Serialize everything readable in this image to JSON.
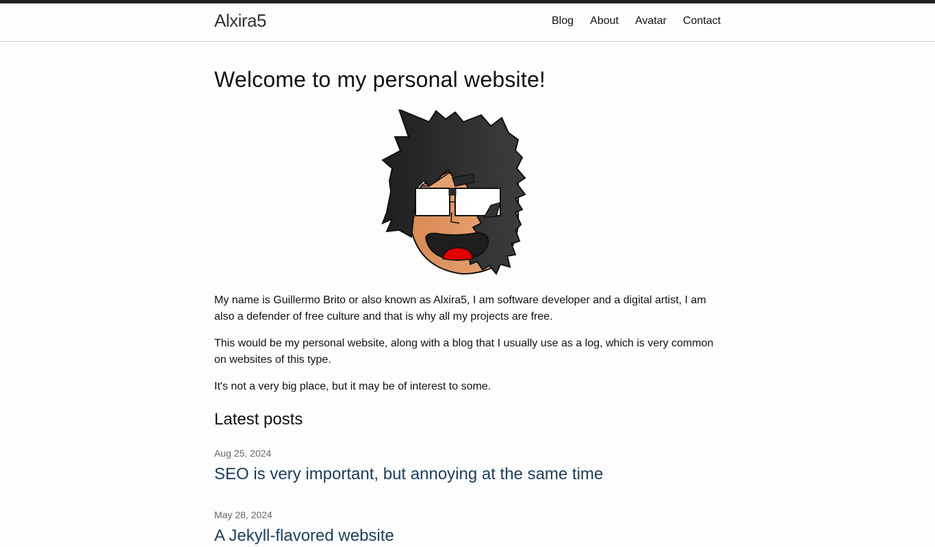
{
  "header": {
    "site_title": "Alxira5",
    "nav": [
      "Blog",
      "About",
      "Avatar",
      "Contact"
    ]
  },
  "main": {
    "heading": "Welcome to my personal website!",
    "paragraphs": [
      "My name is Guillermo Brito or also known as Alxira5, I am software developer and a digital artist, I am also a defender of free culture and that is why all my projects are free.",
      "This would be my personal website, along with a blog that I usually use as a log, which is very common on websites of this type.",
      "It's not a very big place, but it may be of interest to some."
    ],
    "latest_posts_heading": "Latest posts",
    "posts": [
      {
        "date": "Aug 25, 2024",
        "title": "SEO is very important, but annoying at the same time"
      },
      {
        "date": "May 28, 2024",
        "title": "A Jekyll-flavored website"
      }
    ]
  },
  "colors": {
    "top_stripe": "#222222",
    "post_link": "#1c3d5a",
    "hair": "#2e2e2e",
    "skin": "#e8a070",
    "tongue": "#e00000"
  }
}
